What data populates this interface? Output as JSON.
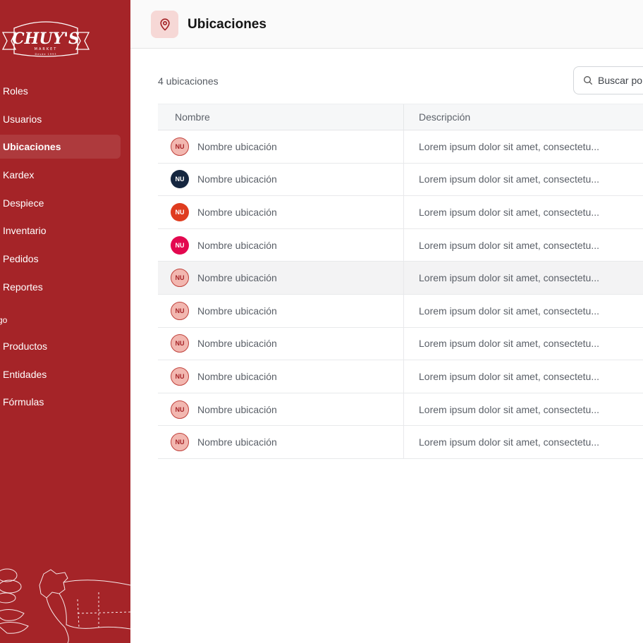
{
  "brand": {
    "name": "CHUY'S",
    "sub": "MARKET",
    "tagline": "Desde 1993"
  },
  "colors": {
    "sidebar": "#a52428",
    "accent": "#c0413b",
    "header_icon_bg": "#f6d8d6"
  },
  "sidebar": {
    "items": [
      {
        "label": "Roles",
        "active": false
      },
      {
        "label": "Usuarios",
        "active": false
      },
      {
        "label": "Ubicaciones",
        "active": true
      },
      {
        "label": "Kardex",
        "active": false
      },
      {
        "label": "Despiece",
        "active": false
      },
      {
        "label": "Inventario",
        "active": false
      },
      {
        "label": "Pedidos",
        "active": false
      },
      {
        "label": "Reportes",
        "active": false
      }
    ],
    "section_label": "go",
    "section_items": [
      {
        "label": "Productos"
      },
      {
        "label": "Entidades"
      },
      {
        "label": "Fórmulas"
      }
    ]
  },
  "header": {
    "icon": "location-pin-icon",
    "title": "Ubicaciones"
  },
  "toolbar": {
    "count": "4 ubicaciones",
    "search_placeholder": "Buscar po"
  },
  "table": {
    "columns": [
      "Nombre",
      "Descripción"
    ],
    "rows": [
      {
        "initials": "NU",
        "name": "Nombre ubicación",
        "desc": "Lorem ipsum dolor sit amet, consectetu...",
        "color": "#f2b7b0"
      },
      {
        "initials": "NU",
        "name": "Nombre ubicación",
        "desc": "Lorem ipsum dolor sit amet, consectetu...",
        "color": "#15263f"
      },
      {
        "initials": "NU",
        "name": "Nombre ubicación",
        "desc": "Lorem ipsum dolor sit amet, consectetu...",
        "color": "#df3c1f"
      },
      {
        "initials": "NU",
        "name": "Nombre ubicación",
        "desc": "Lorem ipsum dolor sit amet, consectetu...",
        "color": "#e3084f"
      },
      {
        "initials": "NU",
        "name": "Nombre ubicación",
        "desc": "Lorem ipsum dolor sit amet, consectetu...",
        "color": "#f2b7b0",
        "highlighted": true
      },
      {
        "initials": "NU",
        "name": "Nombre ubicación",
        "desc": "Lorem ipsum dolor sit amet, consectetu...",
        "color": "#f2b7b0"
      },
      {
        "initials": "NU",
        "name": "Nombre ubicación",
        "desc": "Lorem ipsum dolor sit amet, consectetu...",
        "color": "#f2b7b0"
      },
      {
        "initials": "NU",
        "name": "Nombre ubicación",
        "desc": "Lorem ipsum dolor sit amet, consectetu...",
        "color": "#f2b7b0"
      },
      {
        "initials": "NU",
        "name": "Nombre ubicación",
        "desc": "Lorem ipsum dolor sit amet, consectetu...",
        "color": "#f2b7b0"
      },
      {
        "initials": "NU",
        "name": "Nombre ubicación",
        "desc": "Lorem ipsum dolor sit amet, consectetu...",
        "color": "#f2b7b0"
      }
    ]
  }
}
